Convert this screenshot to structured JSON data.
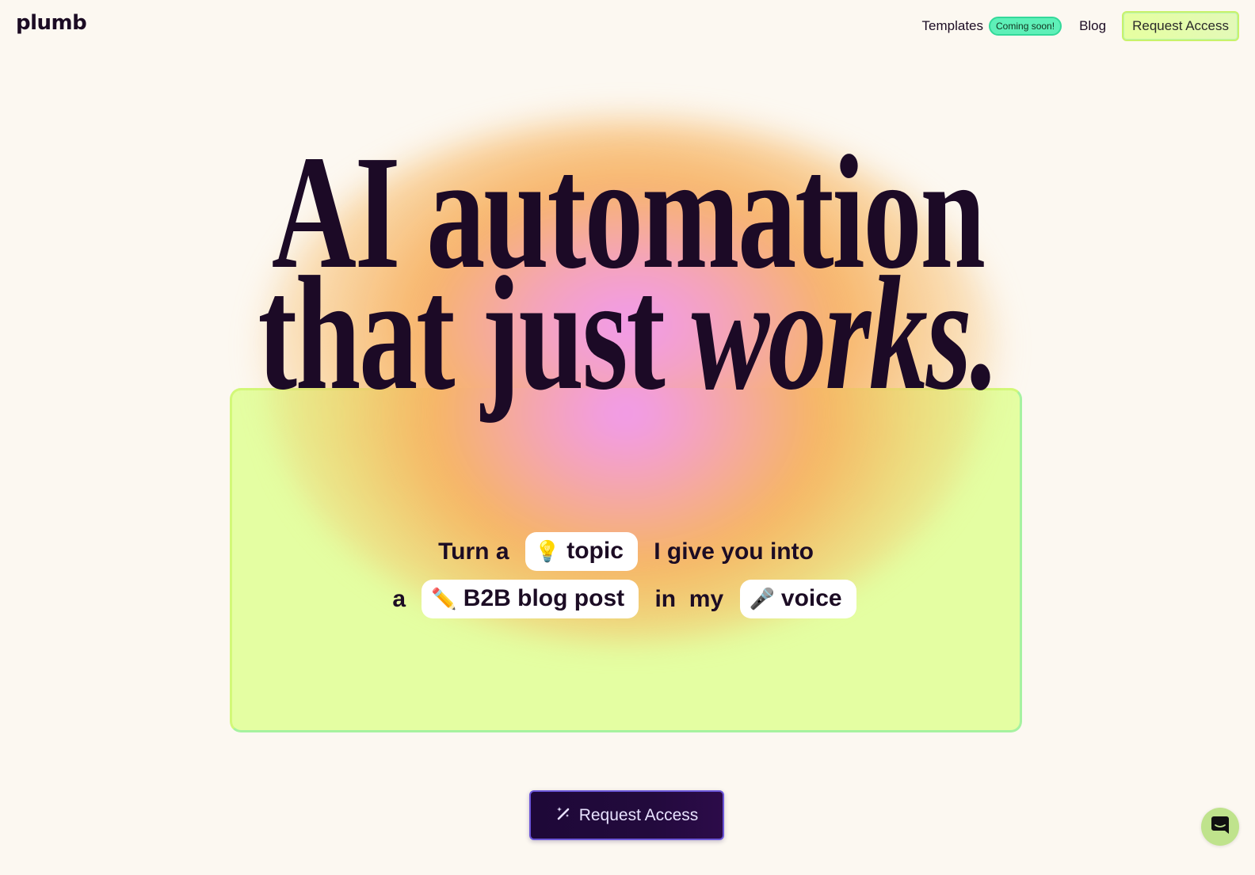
{
  "header": {
    "logo": "plumb",
    "nav": {
      "templates": "Templates",
      "templates_badge": "Coming soon!",
      "blog": "Blog",
      "request_access": "Request Access"
    }
  },
  "hero": {
    "headline_line1": "AI automation",
    "headline_line2_plain": "that just ",
    "headline_line2_italic": "works."
  },
  "card": {
    "line1": {
      "prefix": "Turn a",
      "chip_topic": {
        "icon": "lightbulb-icon",
        "emoji": "💡",
        "label": "topic"
      },
      "suffix": "I give you into"
    },
    "line2": {
      "prefix": "a",
      "chip_format": {
        "icon": "pencil-icon",
        "emoji": "✏️",
        "label": "B2B blog post"
      },
      "middle": "in  my",
      "chip_voice": {
        "icon": "microphone-icon",
        "emoji": "🎤",
        "label": "voice"
      }
    }
  },
  "cta": {
    "icon": "magic-wand-icon",
    "label": "Request Access"
  },
  "chat_widget": {
    "icon": "chat-bubble-icon"
  },
  "colors": {
    "background": "#fcf8f1",
    "text": "#1c0c24",
    "badge": "#5ef0b8",
    "card": "#ddff8c",
    "cta": "#1e0838",
    "cta_border": "#6b56d8",
    "chat": "#bfe38c"
  }
}
